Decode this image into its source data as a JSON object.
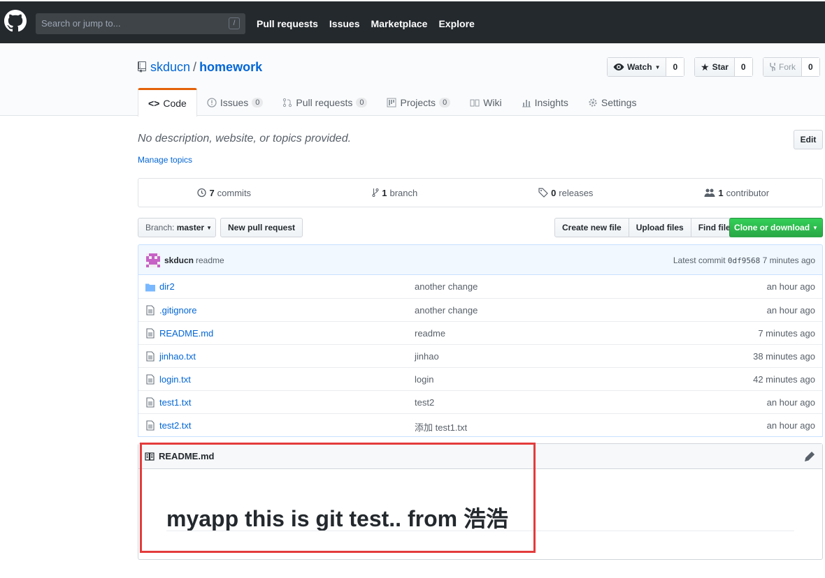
{
  "header": {
    "search_placeholder": "Search or jump to...",
    "search_shortcut": "/",
    "nav": [
      "Pull requests",
      "Issues",
      "Marketplace",
      "Explore"
    ]
  },
  "repo": {
    "owner": "skducn",
    "separator": "/",
    "name": "homework",
    "watch_label": "Watch",
    "watch_count": "0",
    "star_label": "Star",
    "star_count": "0",
    "fork_label": "Fork",
    "fork_count": "0"
  },
  "tabs": [
    {
      "label": "Code",
      "count": null,
      "icon": "code-icon"
    },
    {
      "label": "Issues",
      "count": "0",
      "icon": "issue-icon"
    },
    {
      "label": "Pull requests",
      "count": "0",
      "icon": "pull-request-icon"
    },
    {
      "label": "Projects",
      "count": "0",
      "icon": "project-icon"
    },
    {
      "label": "Wiki",
      "count": null,
      "icon": "book-icon"
    },
    {
      "label": "Insights",
      "count": null,
      "icon": "graph-icon"
    },
    {
      "label": "Settings",
      "count": null,
      "icon": "gear-icon"
    }
  ],
  "description": "No description, website, or topics provided.",
  "manage_topics": "Manage topics",
  "edit_label": "Edit",
  "summary": {
    "commits_num": "7",
    "commits_label": "commits",
    "branch_num": "1",
    "branch_label": "branch",
    "releases_num": "0",
    "releases_label": "releases",
    "contributor_num": "1",
    "contributor_label": "contributor"
  },
  "filenav": {
    "branch_prefix": "Branch:",
    "branch_name": "master",
    "new_pr": "New pull request",
    "create_file": "Create new file",
    "upload_files": "Upload files",
    "find_file": "Find file",
    "clone": "Clone or download"
  },
  "latest_commit": {
    "author": "skducn",
    "message": "readme",
    "prefix": "Latest commit",
    "sha": "0df9568",
    "age": "7 minutes ago"
  },
  "files": [
    {
      "name": "dir2",
      "type": "dir",
      "message": "another change",
      "age": "an hour ago"
    },
    {
      "name": ".gitignore",
      "type": "file",
      "message": "another change",
      "age": "an hour ago"
    },
    {
      "name": "README.md",
      "type": "file",
      "message": "readme",
      "age": "7 minutes ago"
    },
    {
      "name": "jinhao.txt",
      "type": "file",
      "message": "jinhao",
      "age": "38 minutes ago"
    },
    {
      "name": "login.txt",
      "type": "file",
      "message": "login",
      "age": "42 minutes ago"
    },
    {
      "name": "test1.txt",
      "type": "file",
      "message": "test2",
      "age": "an hour ago"
    },
    {
      "name": "test2.txt",
      "type": "file",
      "message": "添加 test1.txt",
      "age": "an hour ago"
    }
  ],
  "readme": {
    "title": "README.md",
    "heading": "myapp this is git test.. from 浩浩"
  },
  "colors": {
    "header_bg": "#24292e",
    "link": "#0366d6",
    "clone_green": "#28a745",
    "tab_active_accent": "#e36209",
    "annotation_red": "#e43c3c"
  }
}
